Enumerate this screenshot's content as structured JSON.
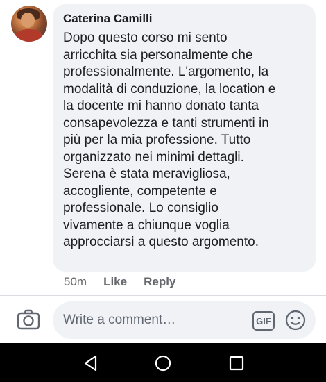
{
  "comment": {
    "author": "Caterina Camilli",
    "text": "Dopo questo corso mi sento\narricchita sia personalmente che\nprofessionalmente. L'argomento, la\nmodalità di conduzione, la location e\nla docente mi hanno donato tanta\nconsapevolezza e tanti strumenti in\npiù per la mia professione. Tutto\norganizzato nei minimi dettagli.\nSerena è stata meravigliosa,\naccogliente, competente e\nprofessionale. Lo consiglio\nvivamente a chiunque voglia\napprocciarsi a questo argomento.",
    "time": "50m",
    "like_label": "Like",
    "reply_label": "Reply"
  },
  "composer": {
    "placeholder": "Write a comment…",
    "gif_label": "GIF"
  },
  "icons": {
    "camera": "camera-icon",
    "gif": "gif-icon",
    "emoji": "smiley-icon",
    "nav_back": "back-triangle-icon",
    "nav_home": "home-circle-icon",
    "nav_recents": "recents-square-icon"
  },
  "colors": {
    "bubble": "#f0f2f5",
    "text": "#1c1e21",
    "meta": "#65676b",
    "navbar": "#000000"
  }
}
